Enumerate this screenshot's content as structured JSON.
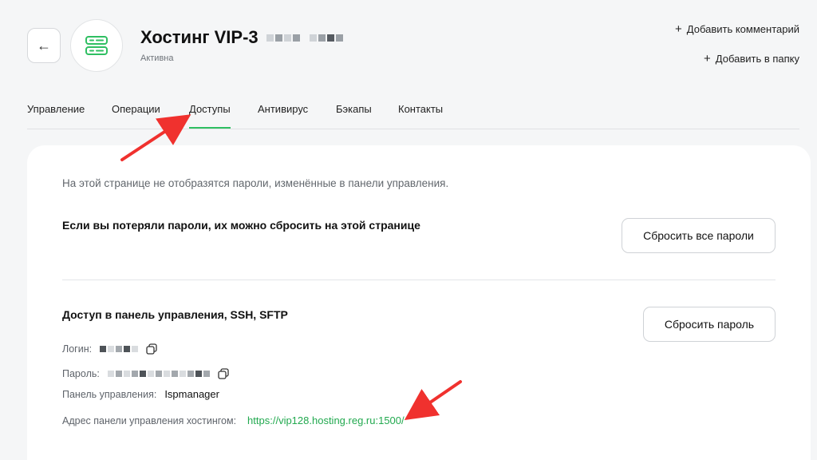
{
  "header": {
    "back_glyph": "←",
    "title": "Хостинг VIP-3",
    "status": "Активна",
    "add_comment": "Добавить комментарий",
    "add_folder": "Добавить в папку",
    "plus_glyph": "+"
  },
  "tabs": [
    {
      "label": "Управление",
      "active": false
    },
    {
      "label": "Операции",
      "active": false
    },
    {
      "label": "Доступы",
      "active": true
    },
    {
      "label": "Антивирус",
      "active": false
    },
    {
      "label": "Бэкапы",
      "active": false
    },
    {
      "label": "Контакты",
      "active": false
    }
  ],
  "card": {
    "notice": "На этой странице не отобразятся пароли, изменённые в панели управления.",
    "reset_heading": "Если вы потеряли пароли, их можно сбросить на этой странице",
    "reset_all_button": "Сбросить все пароли",
    "access_heading": "Доступ в панель управления, SSH, SFTP",
    "reset_button": "Сбросить пароль",
    "login_label": "Логин:",
    "password_label": "Пароль:",
    "panel_label": "Панель управления:",
    "panel_value": "Ispmanager",
    "address_label": "Адрес панели управления хостингом:",
    "address_value": "https://vip128.hosting.reg.ru:1500/"
  },
  "colors": {
    "accent": "#2fbf62",
    "link": "#22a94f",
    "arrow": "#f0312e",
    "background": "#f5f6f7"
  },
  "icons": [
    "back-arrow-icon",
    "server-icon",
    "plus-icon",
    "copy-icon"
  ]
}
